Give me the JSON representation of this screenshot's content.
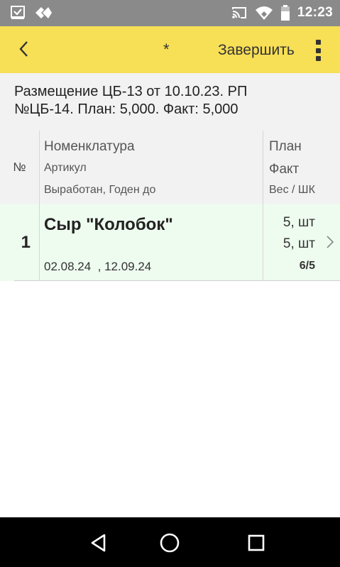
{
  "status_bar": {
    "time": "12:23",
    "icons": [
      "checkbox-notification-icon",
      "diamond-arrows-icon",
      "cast-icon",
      "wifi-icon",
      "battery-icon"
    ]
  },
  "toolbar": {
    "back_icon": "chevron-left-icon",
    "modified_mark": "*",
    "finish_label": "Завершить",
    "more_icon": "more-vertical-icon"
  },
  "document": {
    "line1": "Размещение ЦБ-13 от 10.10.23. РП",
    "line2": "№ЦБ-14. План: 5,000. Факт: 5,000"
  },
  "table": {
    "headers": {
      "num": "№",
      "nomenclature": "Номенклатура",
      "article": "Артикул",
      "dates": "Выработан, Годен до",
      "plan": "План",
      "fact": "Факт",
      "weight_barcode": "Вес / ШК"
    },
    "rows": [
      {
        "num": "1",
        "name": "Сыр \"Колобок\"",
        "dates": "02.08.24  , 12.09.24",
        "plan": "5, шт",
        "fact": "5, шт",
        "ratio": "6/5"
      }
    ]
  },
  "colors": {
    "status_bar": "#8a8a8a",
    "toolbar": "#f7df56",
    "header_bg": "#f2f2f2",
    "row_bg": "#eefbef",
    "nav_bar": "#000000"
  },
  "nav_bar": {
    "icons": [
      "back-triangle-icon",
      "home-circle-icon",
      "recents-square-icon"
    ]
  }
}
